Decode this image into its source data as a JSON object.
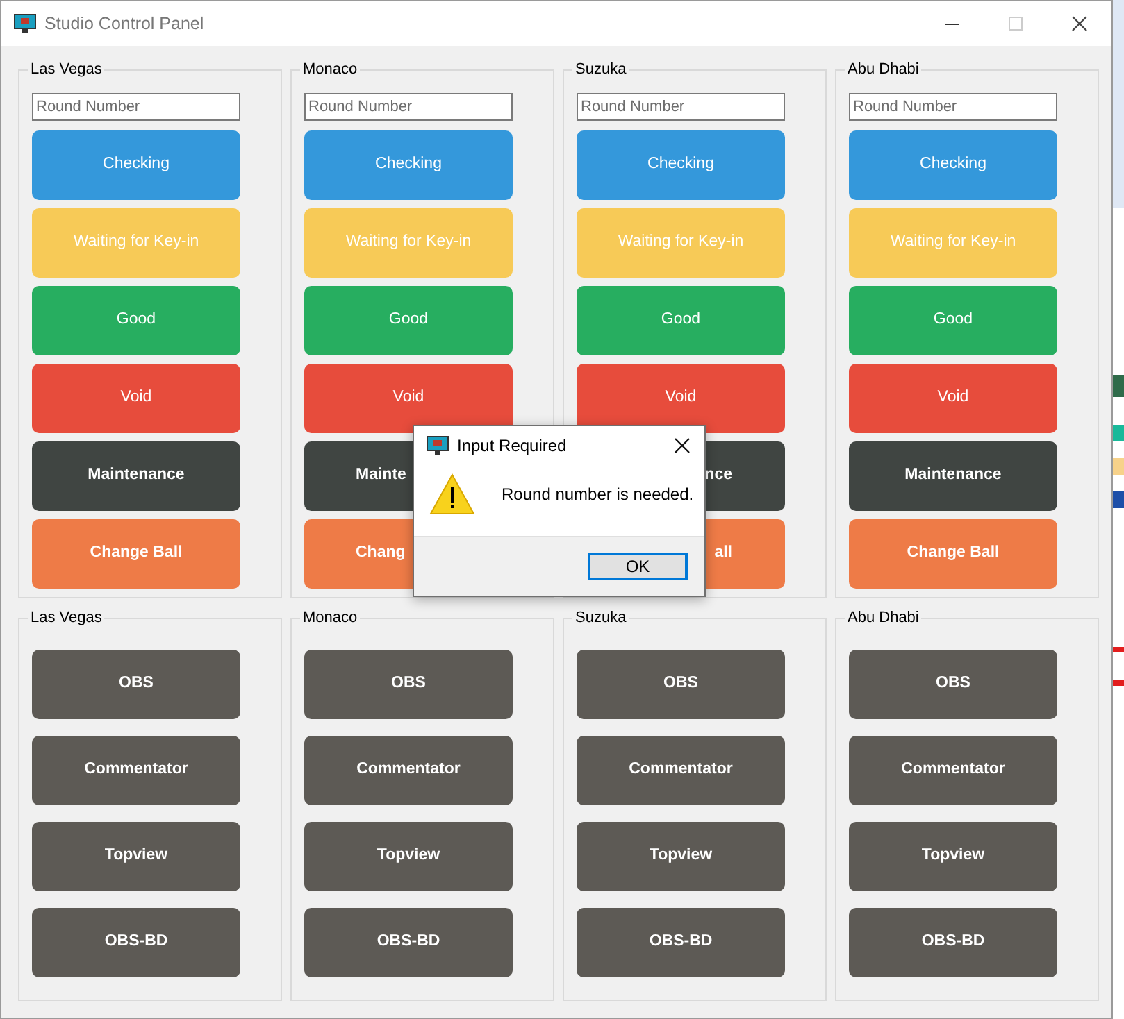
{
  "window": {
    "title": "Studio Control Panel"
  },
  "studios": [
    {
      "name": "Las Vegas",
      "round_field": {
        "placeholder": "Round Number"
      },
      "buttons": [
        {
          "label": "Checking",
          "kind": "checking"
        },
        {
          "label": "Waiting for Key-in",
          "kind": "waiting"
        },
        {
          "label": "Good",
          "kind": "good"
        },
        {
          "label": "Void",
          "kind": "void"
        },
        {
          "label": "Maintenance",
          "kind": "maintenance"
        },
        {
          "label": "Change Ball",
          "kind": "change_ball"
        }
      ]
    },
    {
      "name": "Monaco",
      "round_field": {
        "placeholder": "Round Number"
      },
      "buttons": [
        {
          "label": "Checking",
          "kind": "checking"
        },
        {
          "label": "Waiting for Key-in",
          "kind": "waiting"
        },
        {
          "label": "Good",
          "kind": "good"
        },
        {
          "label": "Void",
          "kind": "void"
        },
        {
          "label": "Mainte",
          "kind": "maintenance",
          "covered_right": true
        },
        {
          "label": "Chang",
          "kind": "change_ball",
          "covered_right": true
        }
      ]
    },
    {
      "name": "Suzuka",
      "round_field": {
        "placeholder": "Round Number"
      },
      "buttons": [
        {
          "label": "Checking",
          "kind": "checking"
        },
        {
          "label": "Waiting for Key-in",
          "kind": "waiting"
        },
        {
          "label": "Good",
          "kind": "good"
        },
        {
          "label": "Void",
          "kind": "void"
        },
        {
          "label": "nce",
          "kind": "maintenance",
          "covered_left": true
        },
        {
          "label": "all",
          "kind": "change_ball",
          "covered_left": true
        }
      ]
    },
    {
      "name": "Abu Dhabi",
      "round_field": {
        "placeholder": "Round Number"
      },
      "buttons": [
        {
          "label": "Checking",
          "kind": "checking"
        },
        {
          "label": "Waiting for Key-in",
          "kind": "waiting"
        },
        {
          "label": "Good",
          "kind": "good"
        },
        {
          "label": "Void",
          "kind": "void"
        },
        {
          "label": "Maintenance",
          "kind": "maintenance"
        },
        {
          "label": "Change Ball",
          "kind": "change_ball"
        }
      ]
    }
  ],
  "cameras": [
    {
      "name": "Las Vegas",
      "buttons": [
        "OBS",
        "Commentator",
        "Topview",
        "OBS-BD"
      ]
    },
    {
      "name": "Monaco",
      "buttons": [
        "OBS",
        "Commentator",
        "Topview",
        "OBS-BD"
      ]
    },
    {
      "name": "Suzuka",
      "buttons": [
        "OBS",
        "Commentator",
        "Topview",
        "OBS-BD"
      ]
    },
    {
      "name": "Abu Dhabi",
      "buttons": [
        "OBS",
        "Commentator",
        "Topview",
        "OBS-BD"
      ]
    }
  ],
  "dialog": {
    "title": "Input Required",
    "message": "Round number is needed.",
    "button": "OK"
  }
}
